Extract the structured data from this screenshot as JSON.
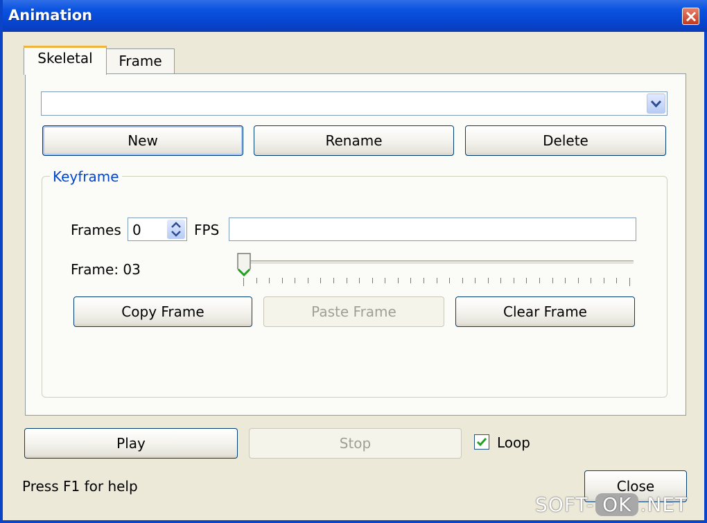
{
  "window": {
    "title": "Animation",
    "close_icon": "close-icon"
  },
  "tabs": [
    {
      "label": "Skeletal",
      "active": true
    },
    {
      "label": "Frame",
      "active": false
    }
  ],
  "skeletal": {
    "animation_combo_value": "",
    "buttons": {
      "new": "New",
      "rename": "Rename",
      "delete": "Delete"
    }
  },
  "keyframe": {
    "group_label": "Keyframe",
    "frames_label": "Frames",
    "frames_value": "0",
    "fps_label": "FPS",
    "fps_value": "",
    "frame_label": "Frame: 03",
    "slider_position": 0,
    "buttons": {
      "copy": "Copy Frame",
      "paste": "Paste Frame",
      "clear": "Clear Frame"
    }
  },
  "playback": {
    "play": "Play",
    "stop": "Stop",
    "loop_label": "Loop",
    "loop_checked": true
  },
  "status": {
    "help_text": "Press F1 for help"
  },
  "footer": {
    "close": "Close"
  },
  "watermark": {
    "left": "SOFT-",
    "middle": "OK",
    "right": ".NET"
  },
  "colors": {
    "title_blue": "#0b53e0",
    "group_label": "#0046d5",
    "tab_highlight": "#f2b33d"
  }
}
